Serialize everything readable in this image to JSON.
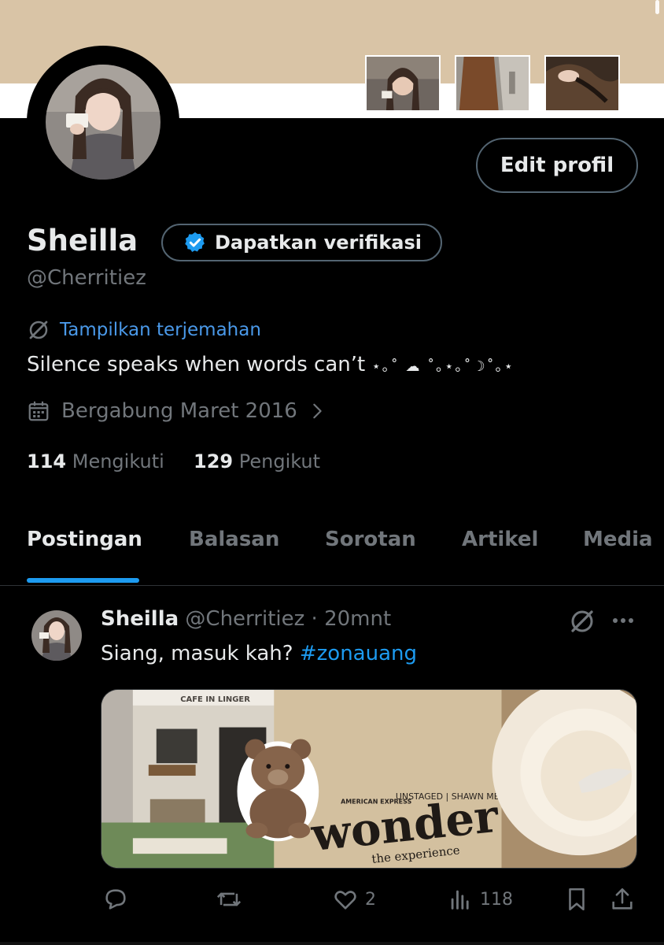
{
  "profile": {
    "name": "Sheilla",
    "handle": "@Cherritiez",
    "verify_label": "Dapatkan verifikasi",
    "edit_label": "Edit profil",
    "translate_label": "Tampilkan terjemahan",
    "bio_text": "Silence speaks when words can’t ",
    "bio_deco": "⋆｡˚ ☁︎ ˚｡⋆｡˚☽˚｡⋆",
    "joined": "Bergabung Maret 2016",
    "following_count": "114",
    "following_label": "Mengikuti",
    "followers_count": "129",
    "followers_label": "Pengikut"
  },
  "tabs": [
    {
      "label": "Postingan",
      "active": true
    },
    {
      "label": "Balasan",
      "active": false
    },
    {
      "label": "Sorotan",
      "active": false
    },
    {
      "label": "Artikel",
      "active": false
    },
    {
      "label": "Media",
      "active": false
    }
  ],
  "post": {
    "author": "Sheilla",
    "handle": "@Cherritiez",
    "sep": "·",
    "time": "20mnt",
    "text": "Siang, masuk kah? ",
    "hashtag": "#zonauang",
    "likes": "2",
    "views": "118",
    "media_signs": {
      "cafe": "CAFE IN LINGER",
      "sponsor": "AMERICAN EXPRESS",
      "unstaged": "UNSTAGED | SHAWN MENDES",
      "big": "wonder",
      "sub": "the experience"
    }
  },
  "colors": {
    "accent": "#1d9bf0",
    "link": "#4a99e9",
    "muted": "#71767b",
    "text": "#e7e9ea",
    "border": "#536471"
  },
  "icons": {
    "verify": "verified-badge-icon",
    "translate": "grok-translate-icon",
    "calendar": "calendar-icon",
    "chevron": "chevron-right-icon",
    "reply": "reply-icon",
    "repost": "repost-icon",
    "like": "heart-icon",
    "views": "views-icon",
    "bookmark": "bookmark-icon",
    "share": "share-icon",
    "more": "more-icon"
  }
}
